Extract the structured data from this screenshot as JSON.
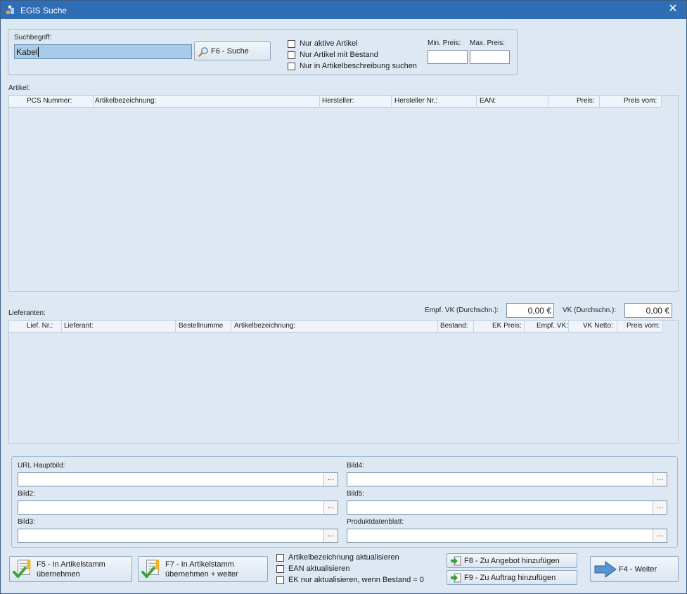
{
  "window": {
    "title": "EGIS Suche"
  },
  "search": {
    "label": "Suchbegriff:",
    "value": "Kabel",
    "button_label": "F6 - Suche",
    "check_active": "Nur aktive Artikel",
    "check_stock": "Nur Artikel mit Bestand",
    "check_description": "Nur in Artikelbeschreibung suchen",
    "min_price_label": "Min. Preis:",
    "max_price_label": "Max. Preis:",
    "min_price_value": "",
    "max_price_value": ""
  },
  "articles": {
    "label": "Artikel:",
    "columns": [
      "PCS Nummer:",
      "Artikelbezeichnung:",
      "Hersteller:",
      "Hersteller Nr.:",
      "EAN:",
      "Preis:",
      "Preis vom:"
    ]
  },
  "suppliers": {
    "label": "Lieferanten:",
    "empf_vk_label": "Empf. VK (Durchschn.):",
    "empf_vk_value": "0,00 €",
    "vk_label": "VK (Durchschn.):",
    "vk_value": "0,00 €",
    "columns": [
      "Lief. Nr.:",
      "Lieferant:",
      "Bestellnumme",
      "Artikelbezeichnung:",
      "Bestand:",
      "EK Preis:",
      "Empf. VK:",
      "VK Netto:",
      "Preis vom:"
    ]
  },
  "images": {
    "url_main_label": "URL Hauptbild:",
    "bild2_label": "Bild2:",
    "bild3_label": "Bild3:",
    "bild4_label": "Bild4:",
    "bild5_label": "Bild5:",
    "datasheet_label": "Produktdatenblatt:",
    "browse_label": "..."
  },
  "footer": {
    "f5_line1": "F5 - In Artikelstamm",
    "f5_line2": "übernehmen",
    "f7_line1": "F7 - In Artikelstamm",
    "f7_line2": "übernehmen + weiter",
    "check_update_desc": "Artikelbezeichnung aktualisieren",
    "check_update_ean": "EAN aktualisieren",
    "check_update_ek": "EK nur aktualisieren, wenn Bestand = 0",
    "f8_label": "F8 - Zu Angebot hinzufügen",
    "f9_label": "F9 - Zu Auftrag hinzufügen",
    "f4_label": "F4 - Weiter"
  },
  "icons": {
    "app": "egis-app-icon",
    "close": "close-icon",
    "search": "magnifier-icon",
    "checklist": "checklist-warning-icon",
    "add_to": "green-arrow-into-box-icon",
    "next": "blue-arrow-right-icon"
  },
  "colors": {
    "titlebar": "#2f6eb5",
    "background": "#dde8f3",
    "selection": "#a9cbea"
  }
}
